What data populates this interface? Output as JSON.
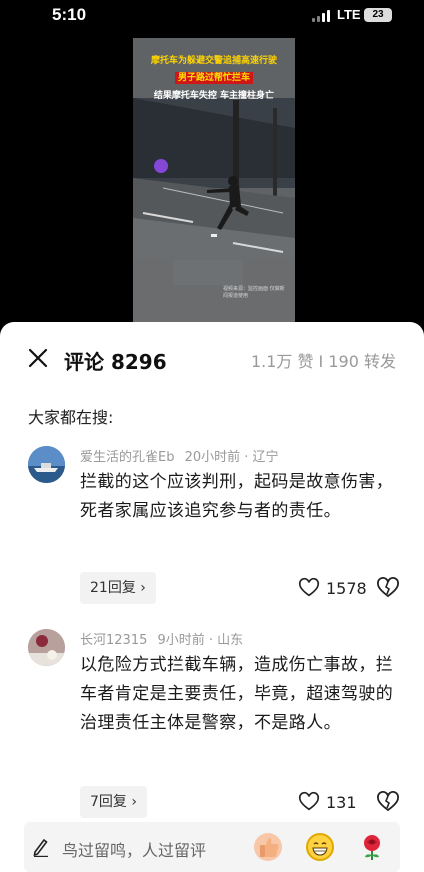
{
  "status_bar": {
    "time": "5:10",
    "network": "LTE",
    "battery": "23"
  },
  "video": {
    "caption_line1": "摩托车为躲避交警追捕高速行驶",
    "caption_line2": "男子路过帮忙拦车",
    "caption_line3": "结果摩托车失控 车主撞柱身亡",
    "watermark": "视频来源：监控画面 仅做新闻报道使用"
  },
  "comments_panel": {
    "title": "评论 8296",
    "stats": "1.1万 赞 I 190 转发",
    "trending_label": "大家都在搜:",
    "comments": [
      {
        "user": "爱生活的孔雀Eb",
        "meta": "20小时前 · 辽宁",
        "text": "拦截的这个应该判刑，起码是故意伤害，死者家属应该追究参与者的责任。",
        "replies": "21回复",
        "likes": "1578"
      },
      {
        "user": "长河12315",
        "meta": "9小时前 · 山东",
        "text": "以危险方式拦截车辆，造成伤亡事故，拦车者肯定是主要责任，毕竟，超速驾驶的治理责任主体是警察，不是路人。",
        "replies": "7回复",
        "likes": "131"
      }
    ]
  },
  "input_bar": {
    "placeholder": "鸟过留鸣，人过留评",
    "icons": [
      "pen-icon",
      "thumbs-up-emoji",
      "grin-emoji",
      "rose-emoji"
    ]
  }
}
